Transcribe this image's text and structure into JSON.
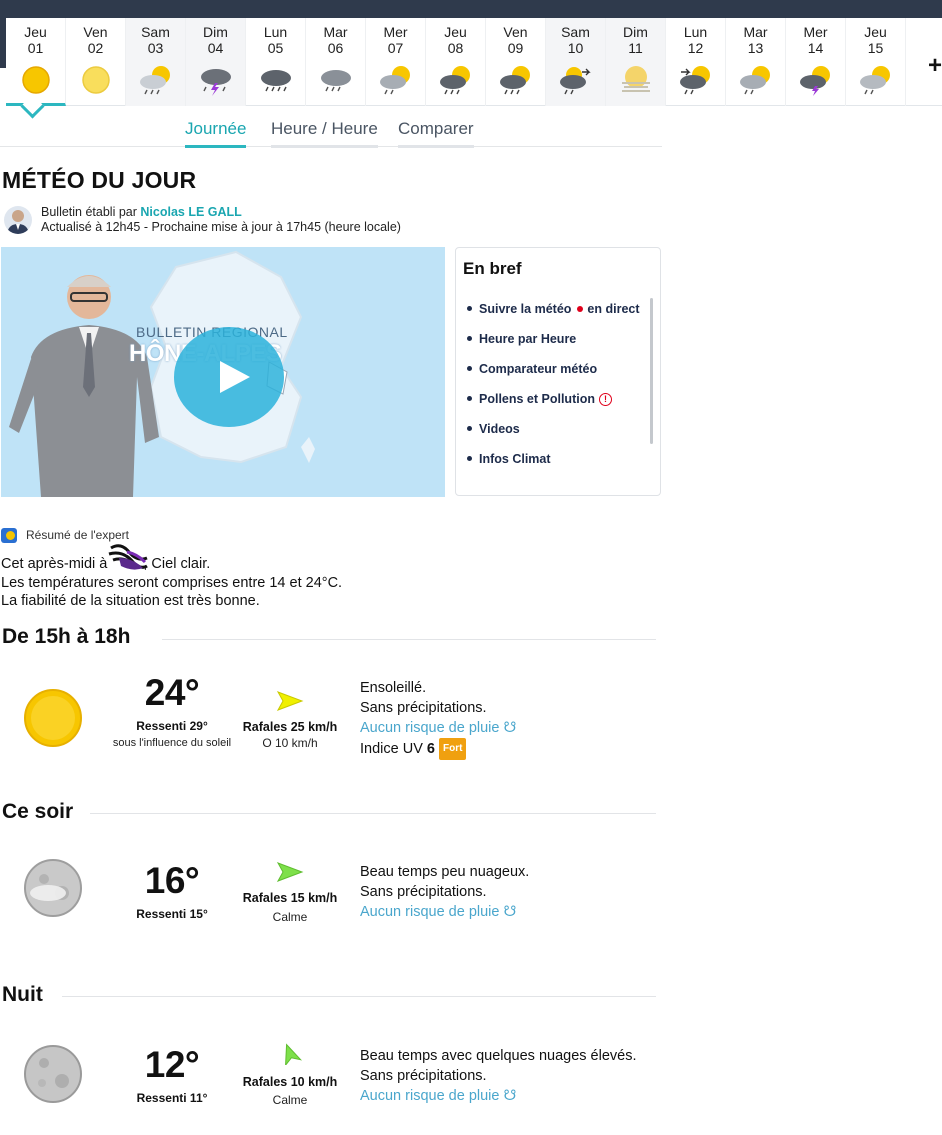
{
  "days": [
    {
      "name": "Jeu",
      "date": "01",
      "icon": "sun-icon"
    },
    {
      "name": "Ven",
      "date": "02",
      "icon": "sun-haze-icon"
    },
    {
      "name": "Sam",
      "date": "03",
      "icon": "sun-cloud-rain-icon"
    },
    {
      "name": "Dim",
      "date": "04",
      "icon": "storm-icon"
    },
    {
      "name": "Lun",
      "date": "05",
      "icon": "cloud-rain-icon"
    },
    {
      "name": "Mar",
      "date": "06",
      "icon": "cloud-rain-icon"
    },
    {
      "name": "Mer",
      "date": "07",
      "icon": "sun-cloud-rain-icon"
    },
    {
      "name": "Jeu",
      "date": "08",
      "icon": "sun-dark-cloud-rain-icon"
    },
    {
      "name": "Ven",
      "date": "09",
      "icon": "sun-dark-cloud-rain-icon"
    },
    {
      "name": "Sam",
      "date": "10",
      "icon": "cloud-rain-wind-icon"
    },
    {
      "name": "Dim",
      "date": "11",
      "icon": "sun-fog-icon"
    },
    {
      "name": "Lun",
      "date": "12",
      "icon": "sun-cloud-rain-wind-icon"
    },
    {
      "name": "Mar",
      "date": "13",
      "icon": "sun-cloud-rain-icon"
    },
    {
      "name": "Mer",
      "date": "14",
      "icon": "sun-storm-icon"
    },
    {
      "name": "Jeu",
      "date": "15",
      "icon": "sun-cloud-rain-icon"
    }
  ],
  "more_days_label": "+",
  "tabs": [
    {
      "label": "Journée",
      "active": true
    },
    {
      "label": "Heure / Heure",
      "active": false
    },
    {
      "label": "Comparer",
      "active": false
    }
  ],
  "header": {
    "title": "MÉTÉO DU JOUR",
    "bulletin_prefix": "Bulletin établi par",
    "author": "Nicolas LE GALL",
    "update_line": "Actualisé à 12h45 - Prochaine mise à jour à 17h45 (heure locale)"
  },
  "video": {
    "title_line1": "BULLETIN REGIONAL",
    "title_line2": "HÔNE-ALPES",
    "play_icon": "play-icon"
  },
  "bref": {
    "title": "En bref",
    "items": [
      {
        "label": "Suivre la météo",
        "extra": "en direct"
      },
      {
        "label": "Heure par Heure"
      },
      {
        "label": "Comparateur météo"
      },
      {
        "label": "Pollens et Pollution",
        "alert": "!"
      },
      {
        "label": "Videos"
      },
      {
        "label": "Infos Climat"
      }
    ]
  },
  "resume": {
    "label": "Résumé de l'expert",
    "line1_start": "Cet après-midi à",
    "line1_end": ", Ciel clair.",
    "line2": "Les températures seront comprises entre 14 et 24°C.",
    "line3": "La fiabilité de la situation est très bonne."
  },
  "periods": [
    {
      "title": "De 15h à 18h",
      "icon": "sun-icon",
      "temp": "24°",
      "ressenti": "Ressenti 29°",
      "influence": "sous l'influence du soleil",
      "wind_arrow_color": "#f0f000",
      "rafales": "Rafales 25 km/h",
      "wind": "O 10 km/h",
      "desc1": "Ensoleillé.",
      "desc2": "Sans précipitations.",
      "rain": "Aucun risque de pluie",
      "uv_label": "Indice UV",
      "uv_value": "6",
      "uv_badge": "Fort"
    },
    {
      "title": "Ce soir",
      "icon": "moon-cloud-icon",
      "temp": "16°",
      "ressenti": "Ressenti 15°",
      "wind_arrow_color": "#7ee04a",
      "rafales": "Rafales 15 km/h",
      "wind": "Calme",
      "desc1": "Beau temps peu nuageux.",
      "desc2": "Sans précipitations.",
      "rain": "Aucun risque de pluie"
    },
    {
      "title": "Nuit",
      "icon": "moon-icon",
      "temp": "12°",
      "ressenti": "Ressenti 11°",
      "wind_arrow_color": "#7ee04a",
      "rafales": "Rafales 10 km/h",
      "wind": "Calme",
      "desc1": "Beau temps avec quelques nuages élevés.",
      "desc2": "Sans précipitations.",
      "rain": "Aucun risque de pluie"
    }
  ],
  "colors": {
    "accent": "#2cb7c0",
    "link": "#4aa6cc",
    "author": "#1aa6b0",
    "live_dot": "#e0001b",
    "uv_badge": "#f0a010"
  }
}
